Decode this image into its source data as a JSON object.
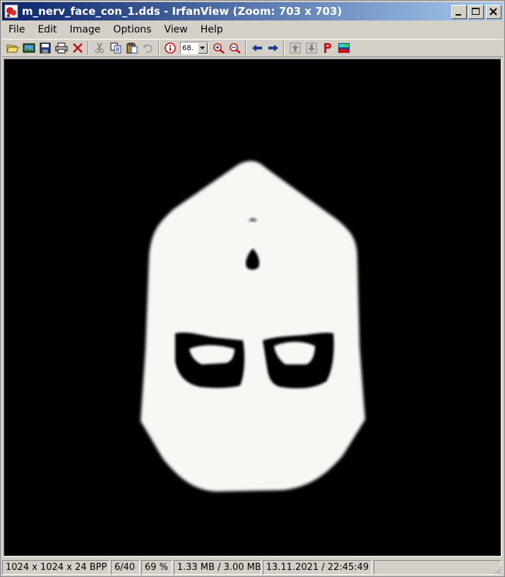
{
  "window": {
    "title": "m_nerv_face_con_1.dds - IrfanView (Zoom: 703 x 703)"
  },
  "menu": {
    "items": [
      "File",
      "Edit",
      "Image",
      "Options",
      "View",
      "Help"
    ]
  },
  "toolbar": {
    "zoom_value": "68.",
    "icons": [
      "open-icon",
      "slideshow-icon",
      "save-icon",
      "print-icon",
      "delete-icon",
      "cut-icon",
      "copy-icon",
      "paste-icon",
      "undo-icon",
      "info-icon",
      "zoom-in-icon",
      "zoom-out-icon",
      "previous-icon",
      "next-icon",
      "page-up-icon",
      "page-down-icon",
      "paint-icon",
      "irfanview-logo-icon"
    ]
  },
  "status": {
    "dimensions": "1024 x 1024 x 24 BPP",
    "index": "6/40",
    "zoom": "69 %",
    "size": "1.33 MB / 3.00 MB",
    "datetime": "13.11.2021 / 22:45:49"
  },
  "colors": {
    "titlebar_start": "#0a246a",
    "titlebar_end": "#a6caf0",
    "chrome": "#d4d0c8",
    "canvas": "#000000",
    "mask": "#f5f8f3"
  }
}
